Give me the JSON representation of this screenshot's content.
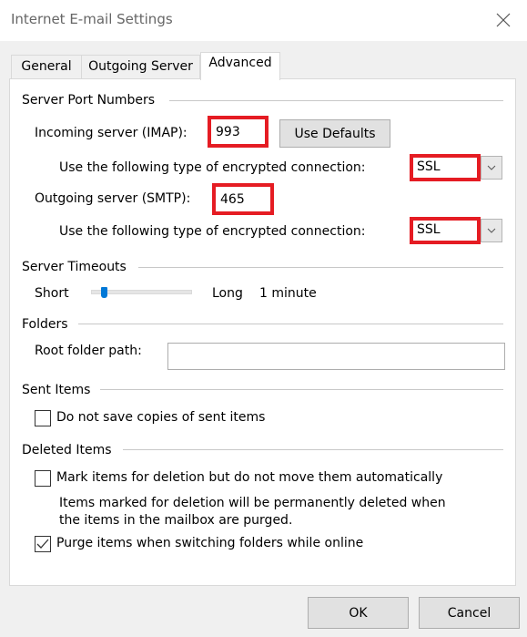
{
  "window": {
    "title": "Internet E-mail Settings",
    "close_icon": "close-icon"
  },
  "tabs": [
    {
      "label": "General",
      "active": false
    },
    {
      "label": "Outgoing Server",
      "active": false
    },
    {
      "label": "Advanced",
      "active": true
    }
  ],
  "server_ports": {
    "header": "Server Port Numbers",
    "incoming_label": "Incoming server (IMAP):",
    "incoming_value": "993",
    "use_defaults_label": "Use Defaults",
    "incoming_encryption_label": "Use the following type of encrypted connection:",
    "incoming_encryption_value": "SSL",
    "outgoing_label": "Outgoing server (SMTP):",
    "outgoing_value": "465",
    "outgoing_encryption_label": "Use the following type of encrypted connection:",
    "outgoing_encryption_value": "SSL"
  },
  "timeouts": {
    "header": "Server Timeouts",
    "short_label": "Short",
    "long_label": "Long",
    "value_label": "1 minute",
    "slider_fraction": 0.1
  },
  "folders": {
    "header": "Folders",
    "root_folder_label": "Root folder path:",
    "root_folder_value": ""
  },
  "sent_items": {
    "header": "Sent Items",
    "do_not_save_label": "Do not save copies of sent items",
    "do_not_save_checked": false
  },
  "deleted_items": {
    "header": "Deleted Items",
    "mark_label": "Mark items for deletion but do not move them automatically",
    "mark_checked": false,
    "mark_note_line1": "Items marked for deletion will be permanently deleted when",
    "mark_note_line2": "the items in the mailbox are purged.",
    "purge_label": "Purge items when switching folders while online",
    "purge_checked": true
  },
  "footer": {
    "ok_label": "OK",
    "cancel_label": "Cancel"
  },
  "colors": {
    "highlight_red": "#e51c23",
    "slider_accent": "#0078d7"
  }
}
